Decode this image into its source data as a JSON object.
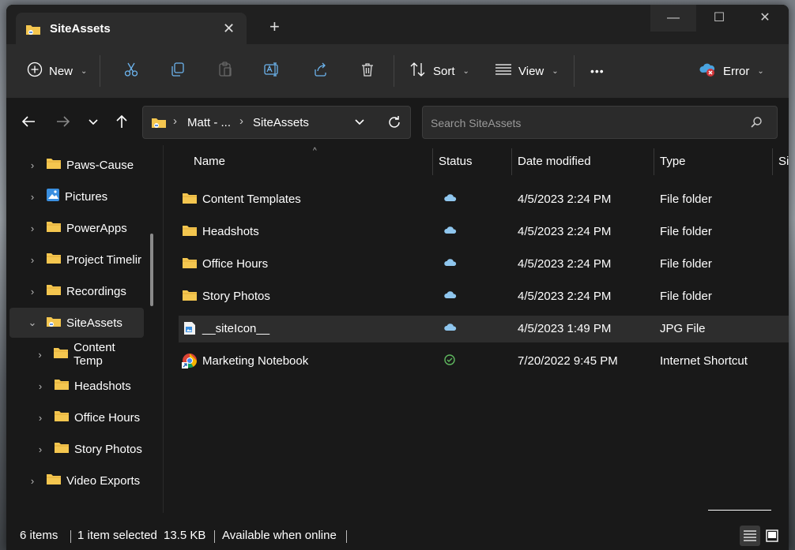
{
  "tab": {
    "title": "SiteAssets",
    "close": "✕",
    "new": "+"
  },
  "window_controls": {
    "minimize": "—",
    "maximize": "☐",
    "close": "✕"
  },
  "toolbar": {
    "new_label": "New",
    "sort_label": "Sort",
    "view_label": "View",
    "more_label": "•••",
    "error_label": "Error"
  },
  "address": {
    "segments": [
      "Matt - ...",
      "SiteAssets"
    ],
    "separator": "›"
  },
  "search": {
    "placeholder": "Search SiteAssets"
  },
  "nav": {
    "items": [
      {
        "label": "Paws-Cause"
      },
      {
        "label": "Pictures"
      },
      {
        "label": "PowerApps"
      },
      {
        "label": "Project Timelir"
      },
      {
        "label": "Recordings"
      },
      {
        "label": "SiteAssets"
      },
      {
        "label": "Content Temp"
      },
      {
        "label": "Headshots"
      },
      {
        "label": "Office Hours"
      },
      {
        "label": "Story Photos"
      },
      {
        "label": "Video Exports"
      }
    ]
  },
  "columns": {
    "name": "Name",
    "status": "Status",
    "date": "Date modified",
    "type": "Type",
    "size": "Si"
  },
  "files": [
    {
      "name": "Content Templates",
      "date": "4/5/2023 2:24 PM",
      "type": "File folder",
      "status": "cloud"
    },
    {
      "name": "Headshots",
      "date": "4/5/2023 2:24 PM",
      "type": "File folder",
      "status": "cloud"
    },
    {
      "name": "Office Hours",
      "date": "4/5/2023 2:24 PM",
      "type": "File folder",
      "status": "cloud"
    },
    {
      "name": "Story Photos",
      "date": "4/5/2023 2:24 PM",
      "type": "File folder",
      "status": "cloud"
    },
    {
      "name": "__siteIcon__",
      "date": "4/5/2023 1:49 PM",
      "type": "JPG File",
      "status": "cloud"
    },
    {
      "name": "Marketing Notebook",
      "date": "7/20/2022 9:45 PM",
      "type": "Internet Shortcut",
      "status": "synced"
    }
  ],
  "statusbar": {
    "items": "6 items",
    "selected": "1 item selected",
    "size": "13.5 KB",
    "availability": "Available when online"
  },
  "colors": {
    "folder": "#f4c64f",
    "cloud": "#8fc6ee",
    "synced": "#5fb85f",
    "error": "#d13438",
    "accent": "#4aa3df"
  }
}
